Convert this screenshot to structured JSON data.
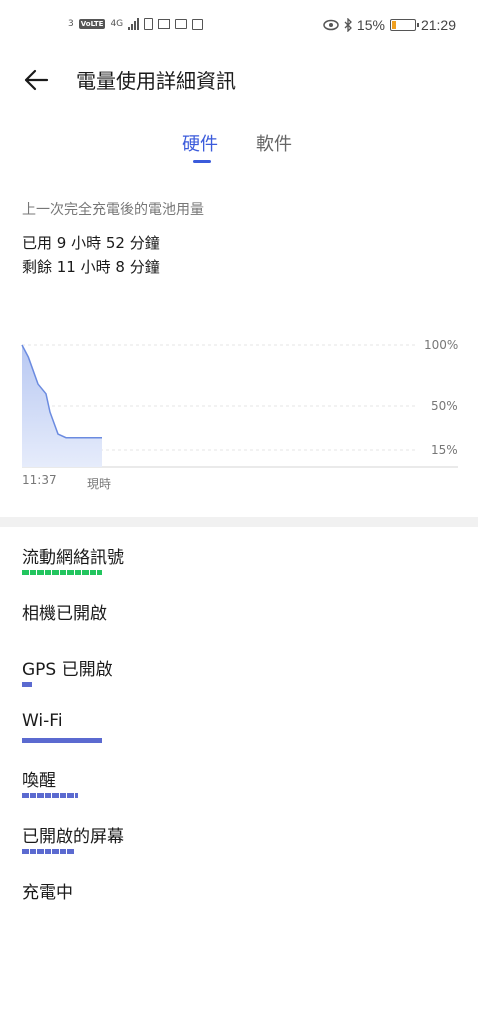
{
  "status_bar": {
    "left_number": "3",
    "volte": "VoLTE",
    "network": "4G",
    "battery_percent": "15%",
    "time": "21:29",
    "icons": [
      "volte-icon",
      "signal-icon",
      "sim-icon",
      "mail-icon",
      "message-icon",
      "bag-icon",
      "eye-icon",
      "bluetooth-icon",
      "battery-icon"
    ]
  },
  "header": {
    "title": "電量使用詳細資訊"
  },
  "tabs": [
    {
      "label": "硬件",
      "selected": true
    },
    {
      "label": "軟件",
      "selected": false
    }
  ],
  "summary": {
    "label": "上一次完全充電後的電池用量",
    "used": "已用 9 小時 52 分鐘",
    "remaining": "剩餘 11 小時 8 分鐘"
  },
  "chart_data": {
    "type": "area",
    "x_start_label": "11:37",
    "x_end_label": "現時",
    "y_ticks": [
      "100%",
      "50%",
      "15%"
    ],
    "ylim": [
      0,
      100
    ],
    "x": [
      0,
      0.08,
      0.2,
      0.3,
      0.35,
      0.45,
      0.55,
      0.65,
      1.0
    ],
    "values": [
      100,
      90,
      68,
      60,
      45,
      27,
      24,
      24,
      24
    ],
    "color": "#6b8be0"
  },
  "usage_items": [
    {
      "label": "流動網絡訊號",
      "color": "#22c55e",
      "fraction": 1.0,
      "style": "segmented"
    },
    {
      "label": "相機已開啟",
      "color": "#5b6ad0",
      "fraction": 0,
      "style": "none"
    },
    {
      "label": "GPS 已開啟",
      "color": "#5b6ad0",
      "fraction": 0.12,
      "style": "solid"
    },
    {
      "label": "Wi-Fi",
      "color": "#5b6ad0",
      "fraction": 1.0,
      "style": "solid"
    },
    {
      "label": "喚醒",
      "color": "#5b6ad0",
      "fraction": 0.7,
      "style": "segmented"
    },
    {
      "label": "已開啟的屏幕",
      "color": "#5b6ad0",
      "fraction": 0.65,
      "style": "segmented"
    },
    {
      "label": "充電中",
      "color": "#5b6ad0",
      "fraction": 0,
      "style": "none"
    }
  ]
}
